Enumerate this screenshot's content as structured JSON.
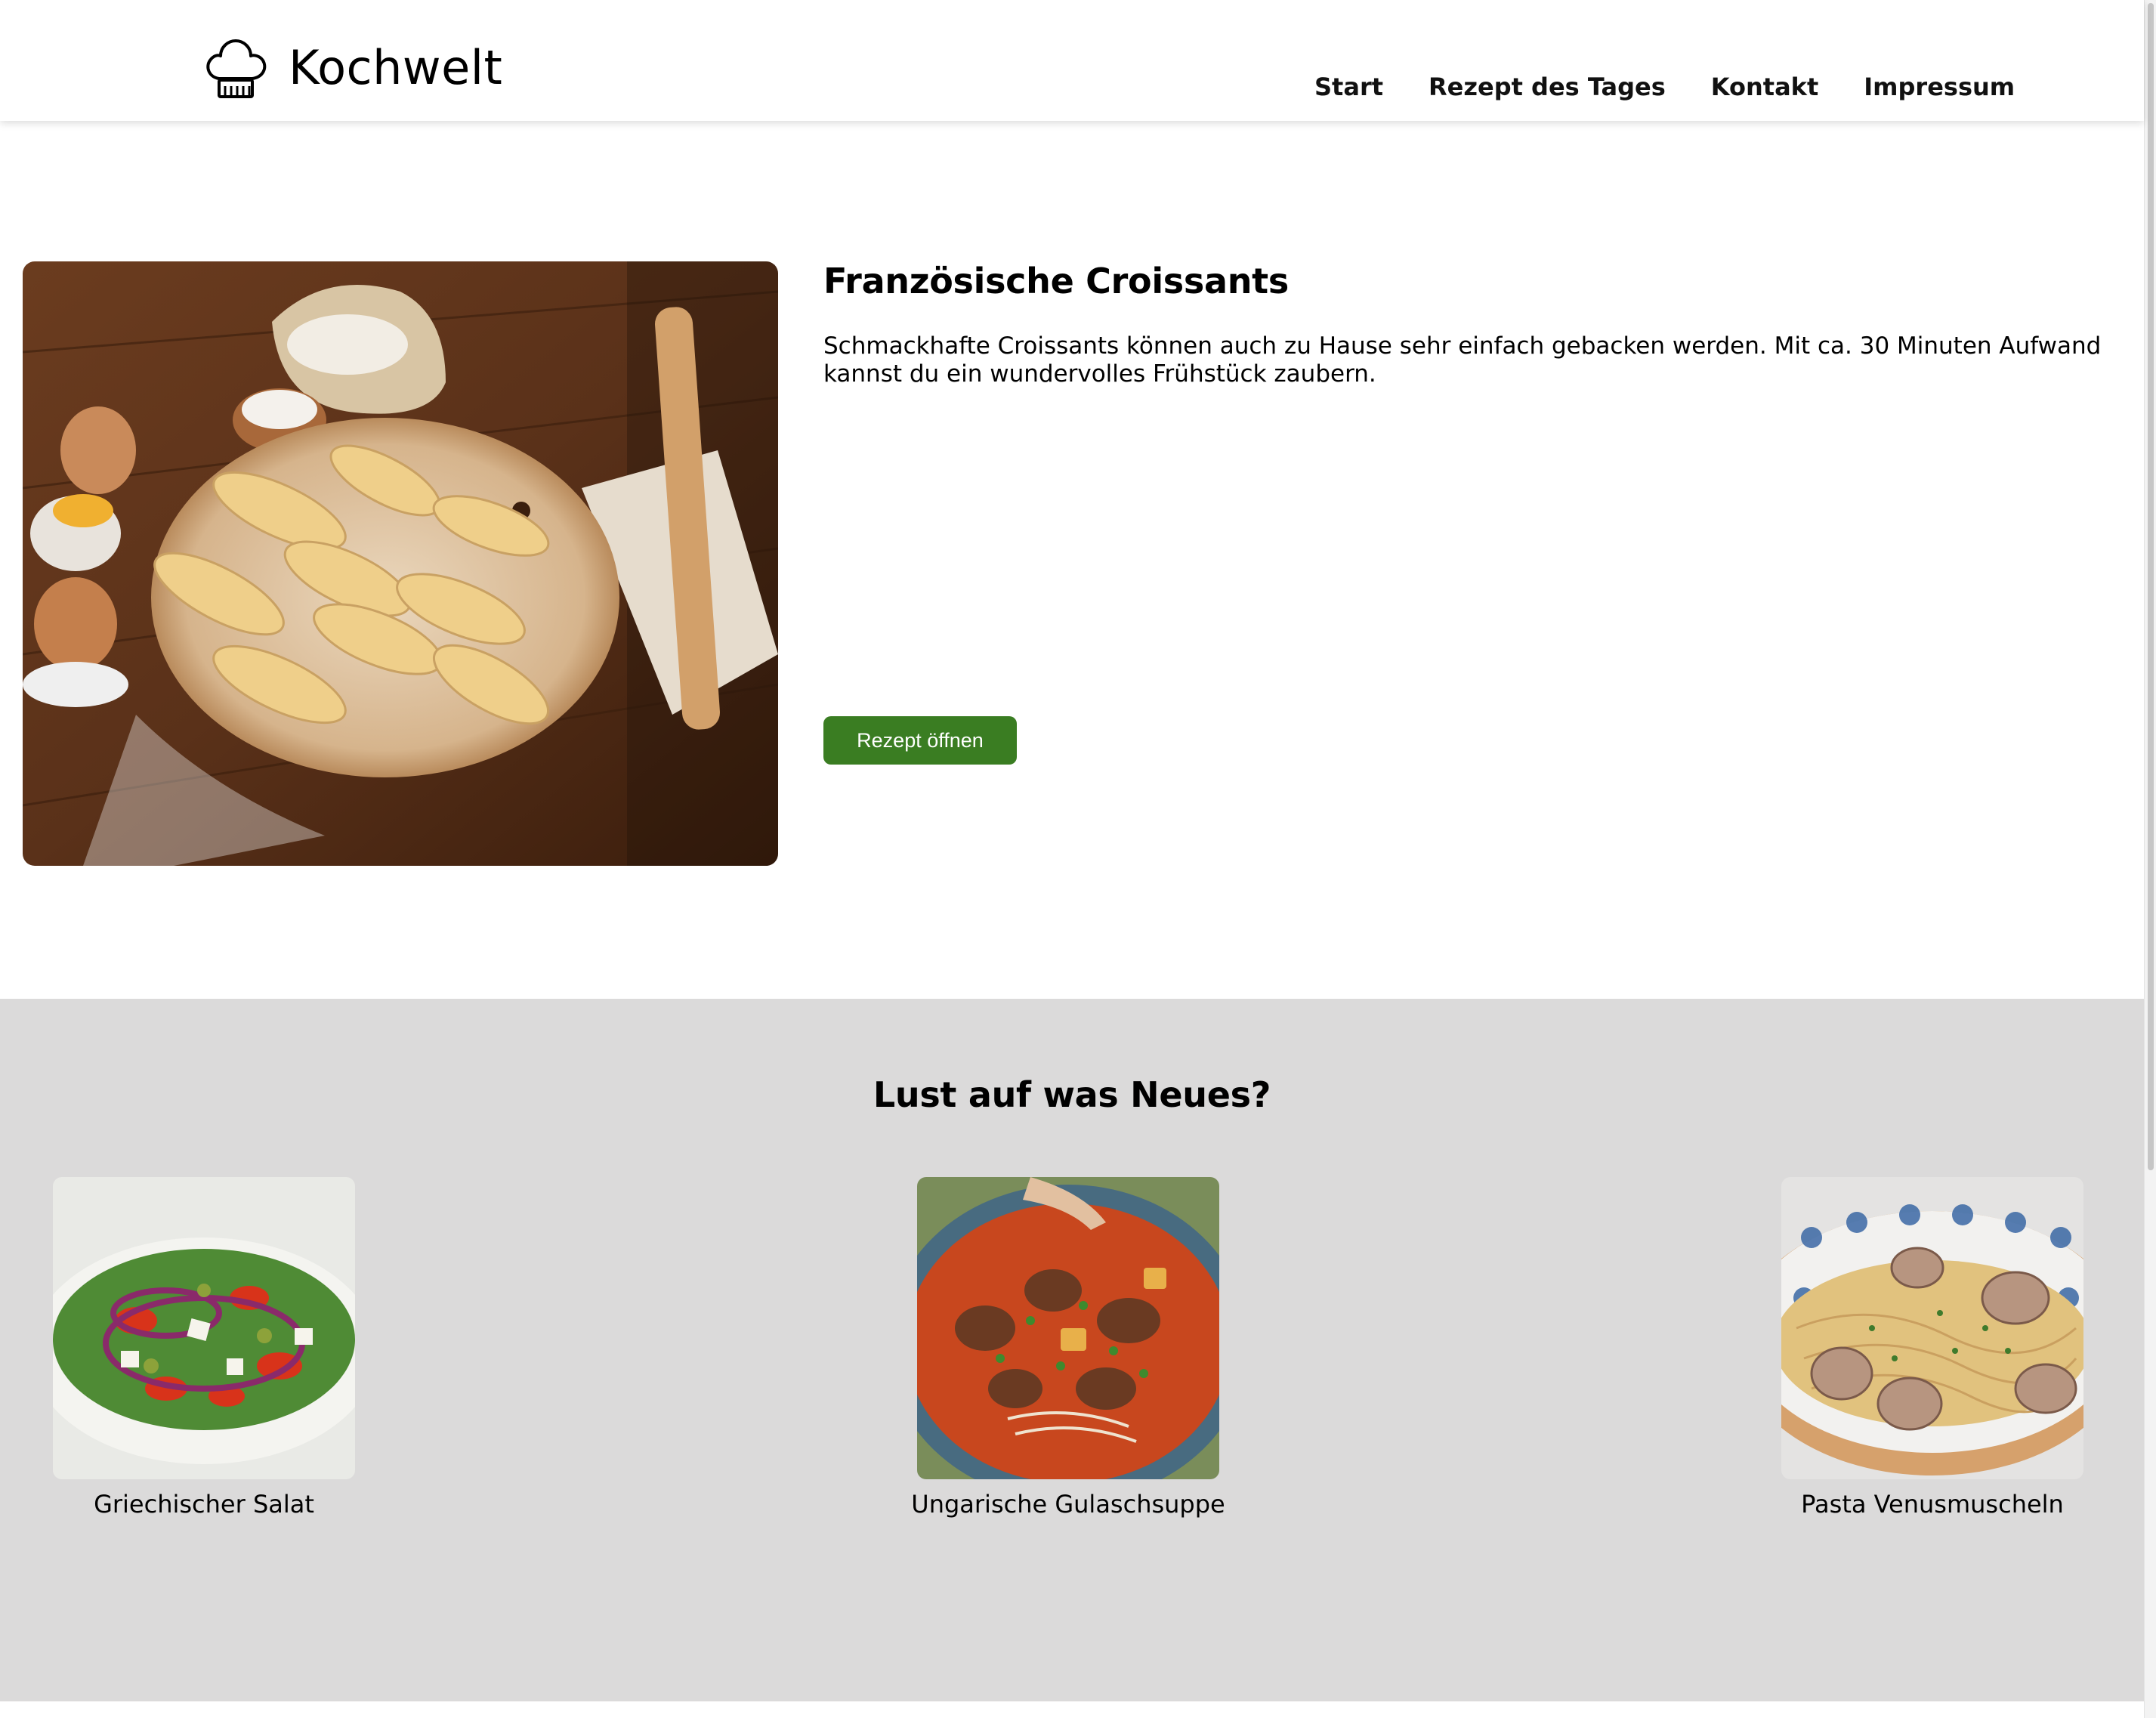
{
  "brand": {
    "name": "Kochwelt",
    "logo_icon": "chef-hat-icon"
  },
  "nav": {
    "items": [
      {
        "label": "Start"
      },
      {
        "label": "Rezept des Tages"
      },
      {
        "label": "Kontakt"
      },
      {
        "label": "Impressum"
      }
    ]
  },
  "featured": {
    "title": "Französische Croissants",
    "description": "Schmackhafte Croissants können auch zu Hause sehr einfach gebacken werden. Mit ca. 30 Minuten Aufwand kannst du ein wundervolles Frühstück zaubern.",
    "button_label": "Rezept öffnen",
    "button_color": "#3a7d22"
  },
  "suggestions": {
    "heading": "Lust auf was Neues?",
    "background": "#dbdada",
    "items": [
      {
        "label": "Griechischer Salat"
      },
      {
        "label": "Ungarische Gulaschsuppe"
      },
      {
        "label": "Pasta Venusmuscheln"
      }
    ]
  }
}
